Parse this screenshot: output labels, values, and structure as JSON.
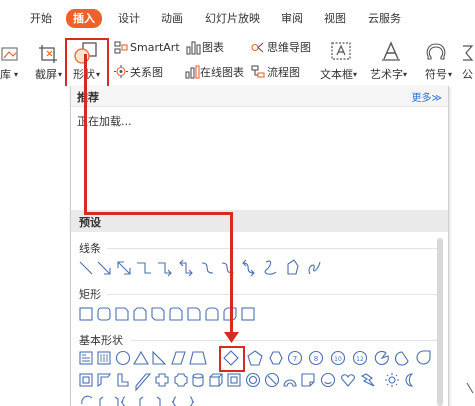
{
  "tabs": [
    "开始",
    "插入",
    "设计",
    "动画",
    "幻灯片放映",
    "审阅",
    "视图",
    "云服务"
  ],
  "active_tab": "插入",
  "ribbon": {
    "partial_left": "库",
    "screenshot": "截屏",
    "shapes": "形状",
    "smartart": "SmartArt",
    "chart": "图表",
    "relation": "关系图",
    "online_chart": "在线图表",
    "mindmap": "思维导图",
    "flowchart": "流程图",
    "textbox": "文本框",
    "wordart": "艺术字",
    "symbol": "符号",
    "partial_right": "公"
  },
  "dropdown_caret": "▾",
  "panel": {
    "recommend_title": "推荐",
    "more": "更多≫",
    "loading": "正在加载...",
    "preset_title": "预设",
    "categories": [
      "线条",
      "矩形",
      "基本形状"
    ]
  },
  "shape_numbers": [
    "7",
    "8",
    "10",
    "12"
  ],
  "accent_color": "#f0602a",
  "highlight_color": "#d62b24",
  "shape_stroke_color": "#4a6fb0"
}
